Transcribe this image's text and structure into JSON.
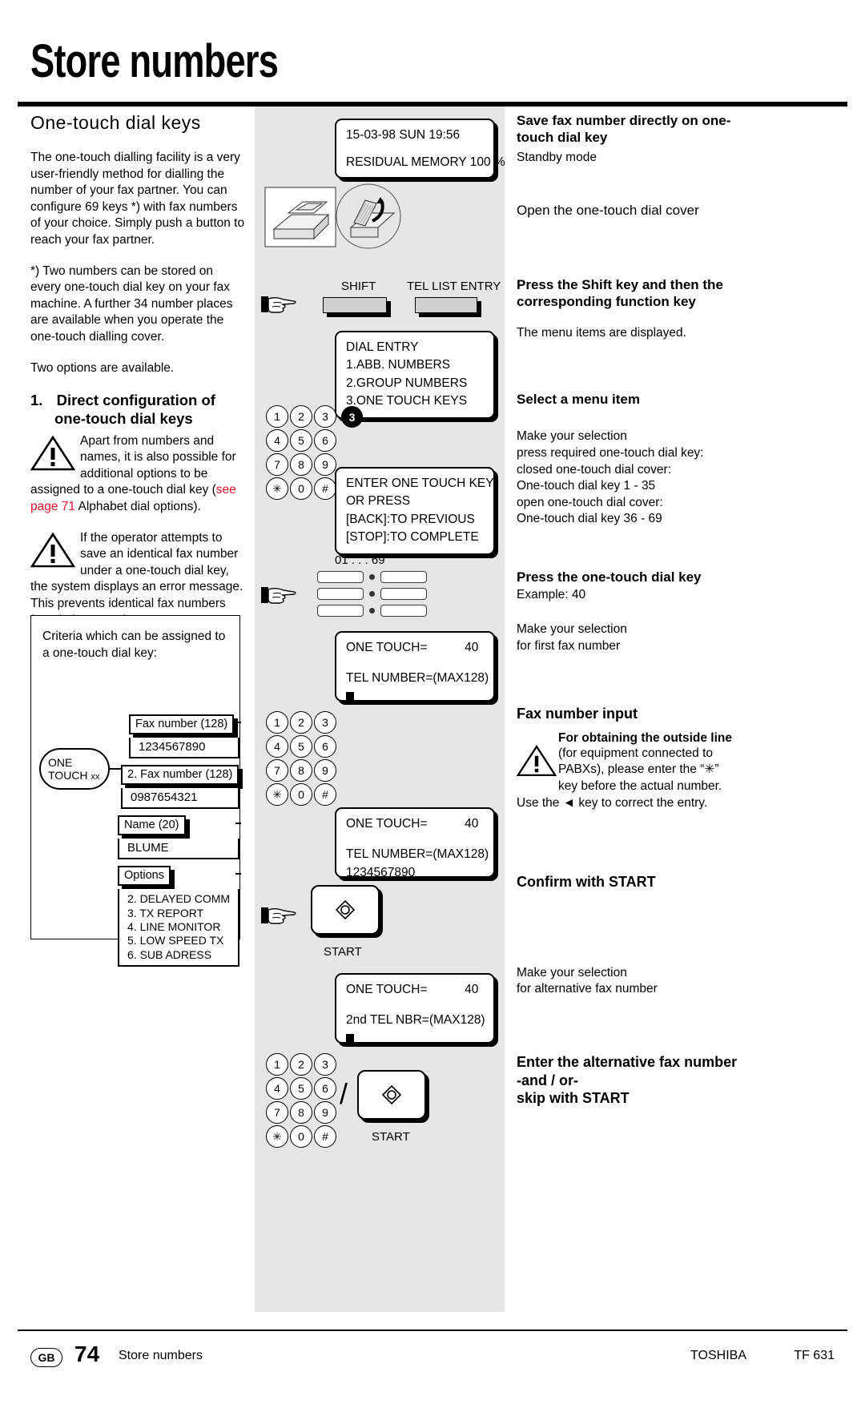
{
  "header": {
    "title": "Store numbers"
  },
  "left": {
    "section_title": "One-touch  dial  keys",
    "p1": "The one-touch dialling facility is a very user-friendly method for dialling the number of your fax partner. You can configure 69 keys *) with fax numbers of your choice. Simply push a button to reach your fax partner.",
    "p2": "*) Two numbers can be stored on every one-touch dial key on your fax machine. A further 34 number places are available when you operate the one-touch dialling cover.",
    "p3": "Two options are available.",
    "h_num": "1.",
    "h_text": "Direct configuration of one-touch dial keys",
    "warn1_a": "Apart from numbers and names, it is also possible for additional options to be assigned to a one-touch dial key (",
    "warn1_link": "see page 71",
    "warn1_b": " Alphabet dial options).",
    "warn2": "If the operator attempts to save an identical fax number under a one-touch dial key, the system displays an error message. This prevents identical fax numbers from being saved.",
    "criteria": {
      "title": "Criteria which can be assigned to a one-touch dial key:",
      "onetouch_line1": "ONE",
      "onetouch_line2": "TOUCH",
      "onetouch_suffix": "xx",
      "fax1_label": "Fax number (128)",
      "fax1_value": "1234567890",
      "fax2_label": "2. Fax number (128)",
      "fax2_value": "0987654321",
      "name_label": "Name (20)",
      "name_value": "BLUME",
      "options_label": "Options",
      "options": [
        "2. DELAYED COMM",
        "3. TX REPORT",
        "4. LINE MONITOR",
        "5. LOW SPEED TX",
        "6. SUB ADRESS"
      ]
    }
  },
  "middle": {
    "lcd1": {
      "line1": "15-03-98     SUN     19:56",
      "line2": "RESIDUAL MEMORY 100 %"
    },
    "shift_label": "SHIFT",
    "tel_list_label": "TEL LIST ENTRY",
    "lcd2": {
      "line1": "DIAL ENTRY",
      "line2": "1.ABB. NUMBERS",
      "line3": "2.GROUP NUMBERS",
      "line4": "3.ONE TOUCH KEYS"
    },
    "badge_3": "3",
    "keypad_rows": [
      [
        "1",
        "2",
        "3"
      ],
      [
        "4",
        "5",
        "6"
      ],
      [
        "7",
        "8",
        "9"
      ],
      [
        "✳",
        "0",
        "#"
      ]
    ],
    "lcd3": {
      "line1": "ENTER ONE TOUCH KEY",
      "line2": "OR PRESS",
      "line3": "[BACK]:TO PREVIOUS",
      "line4": "[STOP]:TO COMPLETE"
    },
    "ot_caption": "01 . . . 69",
    "lcd4": {
      "line1_label": "ONE TOUCH=",
      "line1_value": "40",
      "line2": "TEL NUMBER=(MAX128)",
      "line3_cursor": true
    },
    "lcd5": {
      "line1_label": "ONE TOUCH=",
      "line1_value": "40",
      "line2": "TEL NUMBER=(MAX128)",
      "line3": "1234567890"
    },
    "start_label_1": "START",
    "lcd6": {
      "line1_label": "ONE TOUCH=",
      "line1_value": "40",
      "line2": "2nd TEL NBR=(MAX128)",
      "line3_cursor": true
    },
    "start_label_2": "START",
    "slash": "/"
  },
  "right": {
    "h1_line1": "Save fax number directly on one-",
    "h1_line2": "touch dial key",
    "h1_sub": "Standby mode",
    "t1": "Open the one-touch dial cover",
    "h2_line1": "Press the Shift key and then the",
    "h2_line2": "corresponding function key",
    "t2": "The menu items are displayed.",
    "h3": "Select a menu item",
    "t3_lines": [
      "Make your selection",
      "press required one-touch dial key:",
      "closed one-touch dial cover:",
      "One-touch dial key 1 - 35",
      "open one-touch dial cover:",
      "One-touch dial key 36 - 69"
    ],
    "h4": "Press the one-touch dial key",
    "t4": "Example: 40",
    "t5_lines": [
      "Make your selection",
      "for first fax number"
    ],
    "h5": "Fax number input",
    "warn_title": "For obtaining the outside line",
    "warn_lines": [
      "(for equipment connected to",
      "PABXs), please enter the “✳”",
      "key before the actual number."
    ],
    "warn_tail_a": "Use the ",
    "warn_tail_b": " key to correct the entry.",
    "h6": "Confirm with START",
    "t6_lines": [
      "Make your selection",
      "for alternative fax number"
    ],
    "h7_line1": "Enter the alternative fax number",
    "h7_line2": "-and / or-",
    "h7_line3": "skip with START"
  },
  "footer": {
    "lang": "GB",
    "page": "74",
    "section": "Store numbers",
    "brand": "TOSHIBA",
    "model": "TF 631"
  }
}
